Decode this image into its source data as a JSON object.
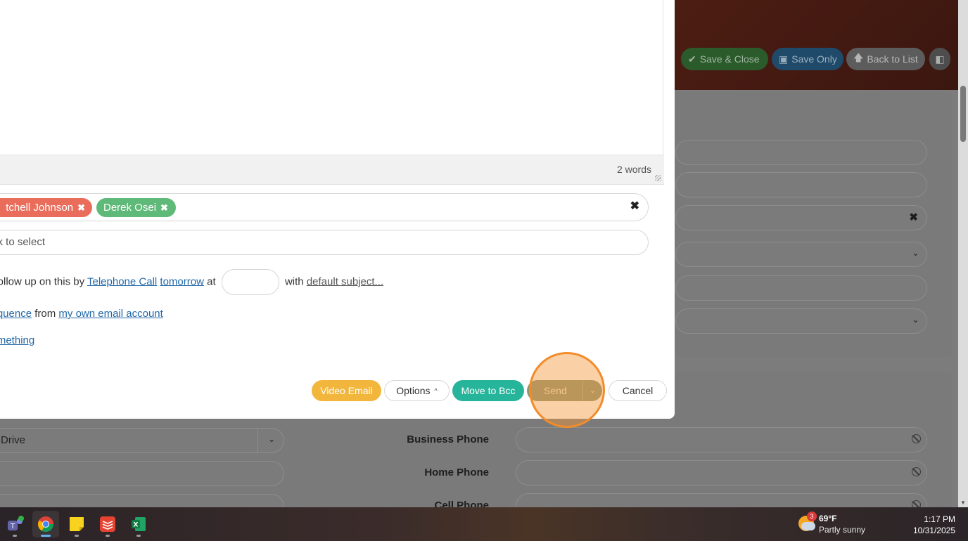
{
  "header": {
    "save_close": "Save & Close",
    "save_only": "Save Only",
    "back_to_list": "Back to List"
  },
  "background_form": {
    "business_phone": "Business Phone",
    "home_phone": "Home Phone",
    "cell_phone": "Cell Phone",
    "left_select_value": "Drive"
  },
  "editor": {
    "word_count": "2 words"
  },
  "recipients": {
    "tags": [
      {
        "label": "Mitchell Johnson",
        "color": "#ea6d5c"
      },
      {
        "label": "Derek Osei",
        "color": "#5fb978"
      }
    ],
    "visible_first_tag": "tchell Johnson"
  },
  "select": {
    "placeholder": "ck to select"
  },
  "followup": {
    "prefix": "o follow up on this by",
    "method": "Telephone Call",
    "when": "tomorrow",
    "at": "at",
    "with": "with",
    "subject": "default subject..."
  },
  "sequence": {
    "link": "sequence",
    "from": "from",
    "account": "my own email account"
  },
  "something": {
    "link": "something"
  },
  "actions": {
    "video_email": "Video Email",
    "options": "Options",
    "move_to_bcc": "Move to Bcc",
    "send": "Send",
    "cancel": "Cancel"
  },
  "taskbar": {
    "weather_temp": "69°F",
    "weather_cond": "Partly sunny",
    "weather_badge": "3",
    "time": "1:17 PM",
    "date": "10/31/2025",
    "apps": [
      "teams-icon",
      "chrome-icon",
      "sticky-notes-icon",
      "todoist-icon",
      "excel-icon"
    ]
  },
  "colors": {
    "accent_green": "#26b49b",
    "video_yellow": "#f2b63c",
    "highlight_orange": "#f28c2b"
  }
}
